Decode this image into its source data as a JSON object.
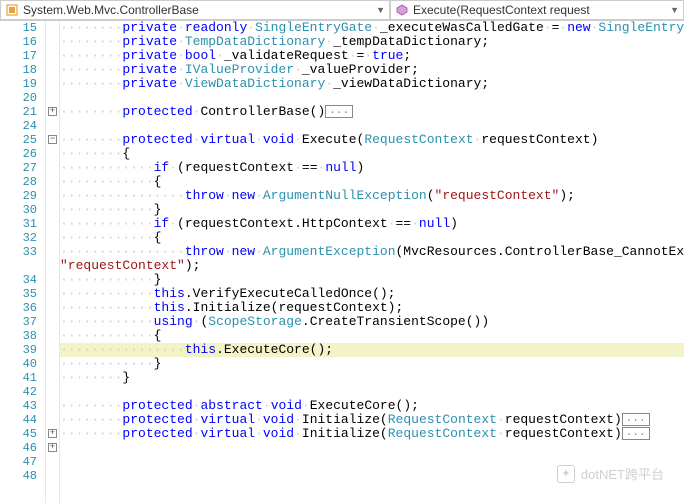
{
  "nav": {
    "left_label": "System.Web.Mvc.ControllerBase",
    "right_label": "Execute(RequestContext request"
  },
  "gutter": {
    "start": 15,
    "lines": [
      15,
      16,
      17,
      18,
      19,
      20,
      21,
      24,
      25,
      26,
      27,
      28,
      29,
      30,
      31,
      32,
      33,
      null,
      34,
      35,
      36,
      37,
      38,
      39,
      40,
      41,
      42,
      43,
      44,
      45,
      46,
      47,
      48
    ]
  },
  "folds": [
    {
      "line_index": 6,
      "state": "+"
    },
    {
      "line_index": 8,
      "state": "-"
    },
    {
      "line_index": 29,
      "state": "+"
    },
    {
      "line_index": 30,
      "state": "+"
    }
  ],
  "current_line_index": 23,
  "code": [
    [
      {
        "t": "ws",
        "v": "········"
      },
      {
        "t": "kw",
        "v": "private"
      },
      {
        "t": "ws",
        "v": "·"
      },
      {
        "t": "kw",
        "v": "readonly"
      },
      {
        "t": "ws",
        "v": "·"
      },
      {
        "t": "type",
        "v": "SingleEntryGate"
      },
      {
        "t": "ws",
        "v": "·"
      },
      {
        "t": "txt",
        "v": "_executeWasCalledGate"
      },
      {
        "t": "ws",
        "v": "·"
      },
      {
        "t": "txt",
        "v": "="
      },
      {
        "t": "ws",
        "v": "·"
      },
      {
        "t": "kw",
        "v": "new"
      },
      {
        "t": "ws",
        "v": "·"
      },
      {
        "t": "type",
        "v": "SingleEntryGate"
      },
      {
        "t": "txt",
        "v": "();"
      }
    ],
    [
      {
        "t": "ws",
        "v": "········"
      },
      {
        "t": "kw",
        "v": "private"
      },
      {
        "t": "ws",
        "v": "·"
      },
      {
        "t": "type",
        "v": "TempDataDictionary"
      },
      {
        "t": "ws",
        "v": "·"
      },
      {
        "t": "txt",
        "v": "_tempDataDictionary;"
      }
    ],
    [
      {
        "t": "ws",
        "v": "········"
      },
      {
        "t": "kw",
        "v": "private"
      },
      {
        "t": "ws",
        "v": "·"
      },
      {
        "t": "kw",
        "v": "bool"
      },
      {
        "t": "ws",
        "v": "·"
      },
      {
        "t": "txt",
        "v": "_validateRequest"
      },
      {
        "t": "ws",
        "v": "·"
      },
      {
        "t": "txt",
        "v": "="
      },
      {
        "t": "ws",
        "v": "·"
      },
      {
        "t": "kw",
        "v": "true"
      },
      {
        "t": "txt",
        "v": ";"
      }
    ],
    [
      {
        "t": "ws",
        "v": "········"
      },
      {
        "t": "kw",
        "v": "private"
      },
      {
        "t": "ws",
        "v": "·"
      },
      {
        "t": "type",
        "v": "IValueProvider"
      },
      {
        "t": "ws",
        "v": "·"
      },
      {
        "t": "txt",
        "v": "_valueProvider;"
      }
    ],
    [
      {
        "t": "ws",
        "v": "········"
      },
      {
        "t": "kw",
        "v": "private"
      },
      {
        "t": "ws",
        "v": "·"
      },
      {
        "t": "type",
        "v": "ViewDataDictionary"
      },
      {
        "t": "ws",
        "v": "·"
      },
      {
        "t": "txt",
        "v": "_viewDataDictionary;"
      }
    ],
    [],
    [
      {
        "t": "ws",
        "v": "········"
      },
      {
        "t": "kw",
        "v": "protected"
      },
      {
        "t": "ws",
        "v": "·"
      },
      {
        "t": "txt",
        "v": "ControllerBase()"
      },
      {
        "t": "collapse",
        "v": "..."
      }
    ],
    [],
    [
      {
        "t": "ws",
        "v": "········"
      },
      {
        "t": "kw",
        "v": "protected"
      },
      {
        "t": "ws",
        "v": "·"
      },
      {
        "t": "kw",
        "v": "virtual"
      },
      {
        "t": "ws",
        "v": "·"
      },
      {
        "t": "kw",
        "v": "void"
      },
      {
        "t": "ws",
        "v": "·"
      },
      {
        "t": "txt",
        "v": "Execute("
      },
      {
        "t": "type",
        "v": "RequestContext"
      },
      {
        "t": "ws",
        "v": "·"
      },
      {
        "t": "txt",
        "v": "requestContext)"
      }
    ],
    [
      {
        "t": "ws",
        "v": "········"
      },
      {
        "t": "txt",
        "v": "{"
      }
    ],
    [
      {
        "t": "ws",
        "v": "············"
      },
      {
        "t": "kw",
        "v": "if"
      },
      {
        "t": "ws",
        "v": "·"
      },
      {
        "t": "txt",
        "v": "(requestContext"
      },
      {
        "t": "ws",
        "v": "·"
      },
      {
        "t": "txt",
        "v": "=="
      },
      {
        "t": "ws",
        "v": "·"
      },
      {
        "t": "kw",
        "v": "null"
      },
      {
        "t": "txt",
        "v": ")"
      }
    ],
    [
      {
        "t": "ws",
        "v": "············"
      },
      {
        "t": "txt",
        "v": "{"
      }
    ],
    [
      {
        "t": "ws",
        "v": "················"
      },
      {
        "t": "kw",
        "v": "throw"
      },
      {
        "t": "ws",
        "v": "·"
      },
      {
        "t": "kw",
        "v": "new"
      },
      {
        "t": "ws",
        "v": "·"
      },
      {
        "t": "type",
        "v": "ArgumentNullException"
      },
      {
        "t": "txt",
        "v": "("
      },
      {
        "t": "str",
        "v": "\"requestContext\""
      },
      {
        "t": "txt",
        "v": ");"
      }
    ],
    [
      {
        "t": "ws",
        "v": "············"
      },
      {
        "t": "txt",
        "v": "}"
      }
    ],
    [
      {
        "t": "ws",
        "v": "············"
      },
      {
        "t": "kw",
        "v": "if"
      },
      {
        "t": "ws",
        "v": "·"
      },
      {
        "t": "txt",
        "v": "(requestContext.HttpContext"
      },
      {
        "t": "ws",
        "v": "·"
      },
      {
        "t": "txt",
        "v": "=="
      },
      {
        "t": "ws",
        "v": "·"
      },
      {
        "t": "kw",
        "v": "null"
      },
      {
        "t": "txt",
        "v": ")"
      }
    ],
    [
      {
        "t": "ws",
        "v": "············"
      },
      {
        "t": "txt",
        "v": "{"
      }
    ],
    [
      {
        "t": "ws",
        "v": "················"
      },
      {
        "t": "kw",
        "v": "throw"
      },
      {
        "t": "ws",
        "v": "·"
      },
      {
        "t": "kw",
        "v": "new"
      },
      {
        "t": "ws",
        "v": "·"
      },
      {
        "t": "type",
        "v": "ArgumentException"
      },
      {
        "t": "txt",
        "v": "(MvcResources.ControllerBase_CannotExecuteWit"
      }
    ],
    [
      {
        "t": "str",
        "v": "\"requestContext\""
      },
      {
        "t": "txt",
        "v": ");"
      }
    ],
    [
      {
        "t": "ws",
        "v": "············"
      },
      {
        "t": "txt",
        "v": "}"
      }
    ],
    [
      {
        "t": "ws",
        "v": "············"
      },
      {
        "t": "kw",
        "v": "this"
      },
      {
        "t": "txt",
        "v": ".VerifyExecuteCalledOnce();"
      }
    ],
    [
      {
        "t": "ws",
        "v": "············"
      },
      {
        "t": "kw",
        "v": "this"
      },
      {
        "t": "txt",
        "v": ".Initialize(requestContext);"
      }
    ],
    [
      {
        "t": "ws",
        "v": "············"
      },
      {
        "t": "kw",
        "v": "using"
      },
      {
        "t": "ws",
        "v": "·"
      },
      {
        "t": "txt",
        "v": "("
      },
      {
        "t": "type",
        "v": "ScopeStorage"
      },
      {
        "t": "txt",
        "v": ".CreateTransientScope())"
      }
    ],
    [
      {
        "t": "ws",
        "v": "············"
      },
      {
        "t": "txt",
        "v": "{"
      }
    ],
    [
      {
        "t": "ws",
        "v": "················"
      },
      {
        "t": "kw",
        "v": "this"
      },
      {
        "t": "txt",
        "v": ".ExecuteCore();"
      }
    ],
    [
      {
        "t": "ws",
        "v": "············"
      },
      {
        "t": "txt",
        "v": "}"
      }
    ],
    [
      {
        "t": "ws",
        "v": "········"
      },
      {
        "t": "txt",
        "v": "}"
      }
    ],
    [],
    [
      {
        "t": "ws",
        "v": "········"
      },
      {
        "t": "kw",
        "v": "protected"
      },
      {
        "t": "ws",
        "v": "·"
      },
      {
        "t": "kw",
        "v": "abstract"
      },
      {
        "t": "ws",
        "v": "·"
      },
      {
        "t": "kw",
        "v": "void"
      },
      {
        "t": "ws",
        "v": "·"
      },
      {
        "t": "txt",
        "v": "ExecuteCore();"
      }
    ],
    [
      {
        "t": "ws",
        "v": "········"
      },
      {
        "t": "kw",
        "v": "protected"
      },
      {
        "t": "ws",
        "v": "·"
      },
      {
        "t": "kw",
        "v": "virtual"
      },
      {
        "t": "ws",
        "v": "·"
      },
      {
        "t": "kw",
        "v": "void"
      },
      {
        "t": "ws",
        "v": "·"
      },
      {
        "t": "txt",
        "v": "Initialize("
      },
      {
        "t": "type",
        "v": "RequestContext"
      },
      {
        "t": "ws",
        "v": "·"
      },
      {
        "t": "txt",
        "v": "requestContext)"
      },
      {
        "t": "collapse",
        "v": "..."
      }
    ],
    [
      {
        "t": "ws",
        "v": "········"
      },
      {
        "t": "kw",
        "v": "protected"
      },
      {
        "t": "ws",
        "v": "·"
      },
      {
        "t": "kw",
        "v": "virtual"
      },
      {
        "t": "ws",
        "v": "·"
      },
      {
        "t": "kw",
        "v": "void"
      },
      {
        "t": "ws",
        "v": "·"
      },
      {
        "t": "txt",
        "v": "Initialize("
      },
      {
        "t": "type",
        "v": "RequestContext"
      },
      {
        "t": "ws",
        "v": "·"
      },
      {
        "t": "txt",
        "v": "requestContext)"
      },
      {
        "t": "collapse",
        "v": "..."
      }
    ],
    [],
    [],
    []
  ],
  "watermark": {
    "text": "dotNET跨平台"
  }
}
